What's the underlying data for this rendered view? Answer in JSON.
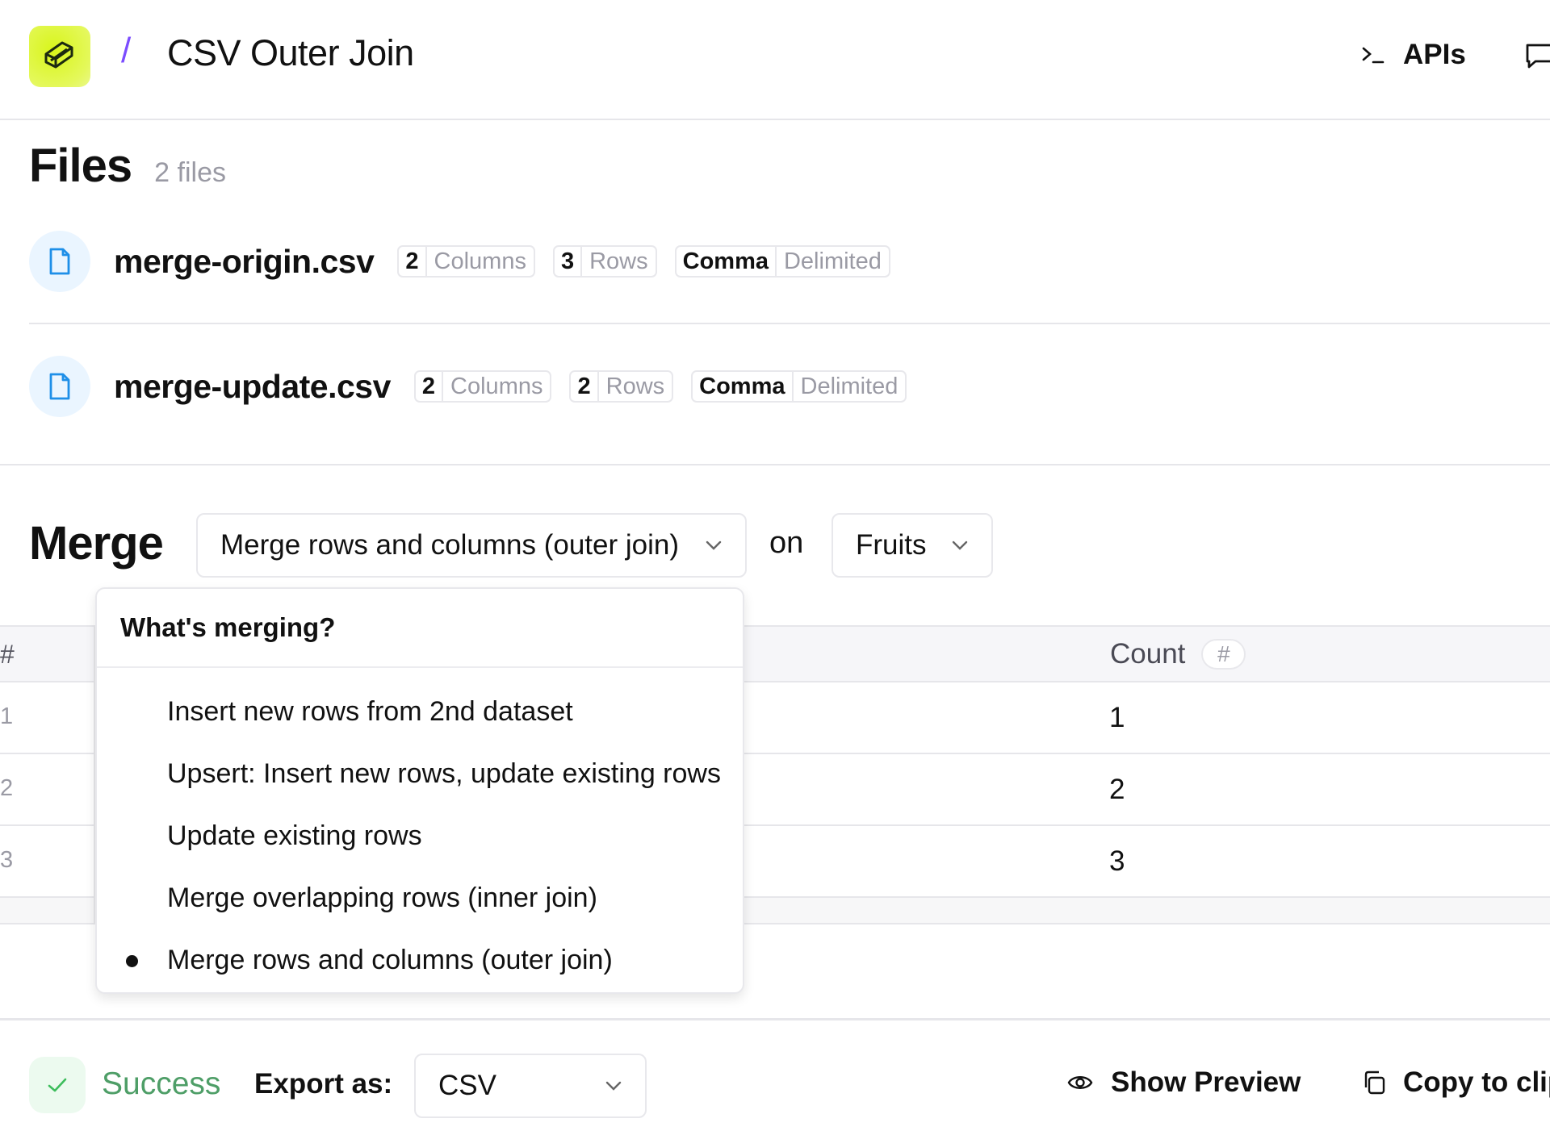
{
  "header": {
    "logo_icon": "stacked-box-logo-icon",
    "breadcrumb_separator": "/",
    "title": "CSV Outer Join",
    "apis_label": "APIs",
    "apis_icon": "terminal-prompt-icon",
    "comment_icon": "comment-icon"
  },
  "files": {
    "title": "Files",
    "count_label": "2 files",
    "items": [
      {
        "name": "merge-origin.csv",
        "columns_value": "2",
        "columns_label": "Columns",
        "rows_value": "3",
        "rows_label": "Rows",
        "delimiter_value": "Comma",
        "delimiter_label": "Delimited"
      },
      {
        "name": "merge-update.csv",
        "columns_value": "2",
        "columns_label": "Columns",
        "rows_value": "2",
        "rows_label": "Rows",
        "delimiter_value": "Comma",
        "delimiter_label": "Delimited"
      }
    ]
  },
  "merge": {
    "title": "Merge",
    "mode_selected": "Merge rows and columns (outer join)",
    "on_label": "on",
    "key_selected": "Fruits",
    "menu": {
      "heading": "What's merging?",
      "options": [
        {
          "label": "Insert new rows from 2nd dataset",
          "selected": false
        },
        {
          "label": "Upsert: Insert new rows, update existing rows",
          "selected": false
        },
        {
          "label": "Update existing rows",
          "selected": false
        },
        {
          "label": "Merge overlapping rows (inner join)",
          "selected": false
        },
        {
          "label": "Merge rows and columns (outer join)",
          "selected": true
        }
      ]
    }
  },
  "table": {
    "row_number_header": "#",
    "columns": [
      {
        "name": "Count",
        "type_badge": "#"
      }
    ],
    "rows": [
      {
        "row_number": "1",
        "Count": "1"
      },
      {
        "row_number": "2",
        "Count": "2"
      },
      {
        "row_number": "3",
        "Count": "3"
      }
    ]
  },
  "footer": {
    "status_text": "Success",
    "status_color": "#4e9e67",
    "export_label": "Export as:",
    "export_format": "CSV",
    "preview_label": "Show Preview",
    "copy_label": "Copy to clipboard"
  },
  "colors": {
    "brand_logo": "#dcf52a",
    "accent_slash": "#7c4dff",
    "file_icon": "#1e8fe8"
  }
}
